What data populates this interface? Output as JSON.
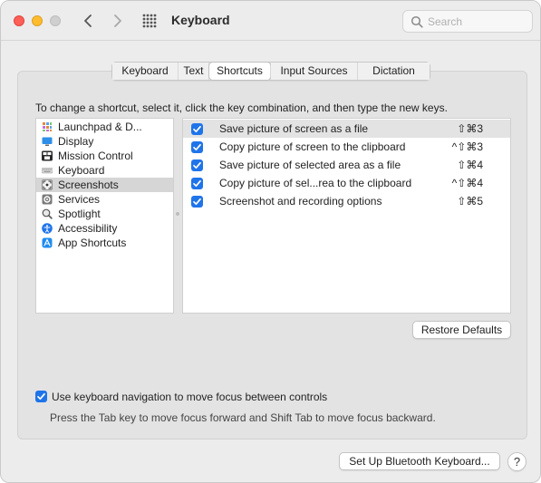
{
  "window": {
    "title": "Keyboard"
  },
  "search": {
    "placeholder": "Search",
    "value": ""
  },
  "tabs": [
    {
      "label": "Keyboard",
      "active": false
    },
    {
      "label": "Text",
      "active": false
    },
    {
      "label": "Shortcuts",
      "active": true
    },
    {
      "label": "Input Sources",
      "active": false
    },
    {
      "label": "Dictation",
      "active": false
    }
  ],
  "instruction": "To change a shortcut, select it, click the key combination, and then type the new keys.",
  "categories": [
    {
      "label": "Launchpad & D...",
      "icon": "launchpad-icon"
    },
    {
      "label": "Display",
      "icon": "display-icon"
    },
    {
      "label": "Mission Control",
      "icon": "mission-control-icon"
    },
    {
      "label": "Keyboard",
      "icon": "keyboard-icon"
    },
    {
      "label": "Screenshots",
      "icon": "screenshots-icon",
      "selected": true
    },
    {
      "label": "Services",
      "icon": "services-icon"
    },
    {
      "label": "Spotlight",
      "icon": "spotlight-icon"
    },
    {
      "label": "Accessibility",
      "icon": "accessibility-icon"
    },
    {
      "label": "App Shortcuts",
      "icon": "app-shortcuts-icon"
    }
  ],
  "shortcuts": [
    {
      "label": "Save picture of screen as a file",
      "keys": "⇧⌘3",
      "checked": true,
      "selected": true
    },
    {
      "label": "Copy picture of screen to the clipboard",
      "keys": "^⇧⌘3",
      "checked": true
    },
    {
      "label": "Save picture of selected area as a file",
      "keys": "⇧⌘4",
      "checked": true
    },
    {
      "label": "Copy picture of sel...rea to the clipboard",
      "keys": "^⇧⌘4",
      "checked": true
    },
    {
      "label": "Screenshot and recording options",
      "keys": "⇧⌘5",
      "checked": true
    }
  ],
  "buttons": {
    "restore_defaults": "Restore Defaults",
    "bluetooth_keyboard": "Set Up Bluetooth Keyboard...",
    "help": "?"
  },
  "keyboard_navigation": {
    "checked": true,
    "label": "Use keyboard navigation to move focus between controls",
    "subtext": "Press the Tab key to move focus forward and Shift Tab to move focus backward."
  },
  "colors": {
    "accent": "#1f74ea",
    "selection": "#d6d6d6"
  }
}
